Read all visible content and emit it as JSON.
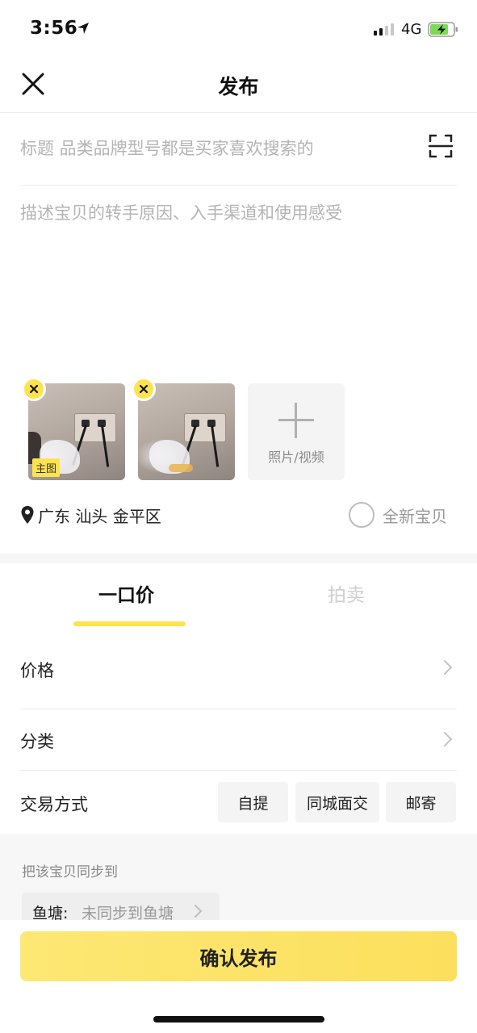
{
  "status_bar": {
    "time": "3:56",
    "network": "4G",
    "signal_bars_active": 2,
    "signal_bars_total": 4,
    "battery_charging": true
  },
  "header": {
    "title": "发布",
    "close_icon": "close-icon"
  },
  "form": {
    "title_placeholder": "标题 品类品牌型号都是买家喜欢搜索的",
    "title_value": "",
    "description_placeholder": "描述宝贝的转手原因、入手渠道和使用感受",
    "description_value": ""
  },
  "media": {
    "main_badge": "主图",
    "add_label": "照片/视频",
    "photo_count": 2
  },
  "location": {
    "text": "广东 汕头 金平区",
    "new_item_label": "全新宝贝",
    "new_item_checked": false
  },
  "tabs": [
    {
      "label": "一口价",
      "active": true
    },
    {
      "label": "拍卖",
      "active": false
    }
  ],
  "fields": {
    "price_label": "价格",
    "category_label": "分类",
    "trade_label": "交易方式",
    "trade_options": [
      "自提",
      "同城面交",
      "邮寄"
    ]
  },
  "sync": {
    "title": "把该宝贝同步到",
    "chip_label": "鱼塘:",
    "chip_value": "未同步到鱼塘"
  },
  "submit_label": "确认发布",
  "colors": {
    "accent": "#ffe34d",
    "button_gradient_start": "#fde874",
    "button_gradient_end": "#fcdf5c",
    "placeholder": "#b4b4b4"
  }
}
